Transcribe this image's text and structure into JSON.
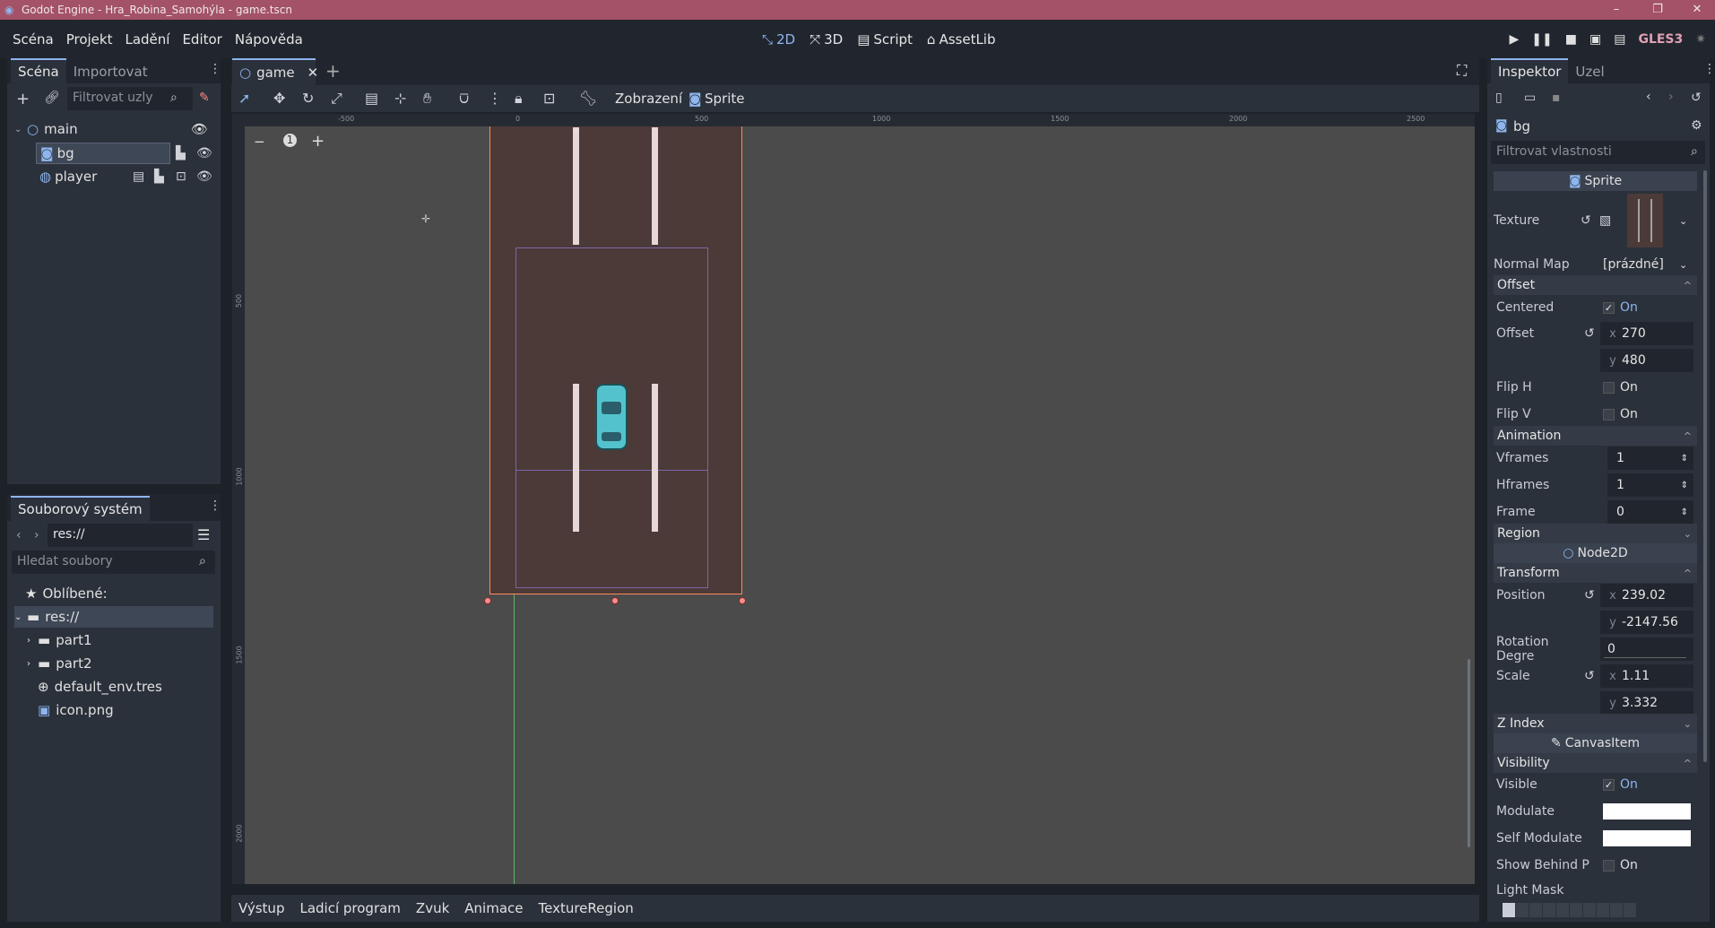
{
  "window": {
    "title": "Godot Engine - Hra_Robina_Samohýla - game.tscn",
    "controls": [
      "–",
      "❐",
      "✕"
    ]
  },
  "menu": [
    "Scéna",
    "Projekt",
    "Ladění",
    "Editor",
    "Nápověda"
  ],
  "workspaces": [
    {
      "label": "2D",
      "icon": "2d-icon",
      "active": true
    },
    {
      "label": "3D",
      "icon": "3d-icon",
      "active": false
    },
    {
      "label": "Script",
      "icon": "script-icon",
      "active": false
    },
    {
      "label": "AssetLib",
      "icon": "assetlib-icon",
      "active": false
    }
  ],
  "renderer": "GLES3",
  "scene_dock": {
    "tabs": [
      "Scéna",
      "Importovat"
    ],
    "filter_placeholder": "Filtrovat uzly",
    "nodes": [
      {
        "name": "main",
        "depth": 0,
        "icon": "node2d-icon"
      },
      {
        "name": "bg",
        "depth": 1,
        "icon": "sprite-icon",
        "selected": true
      },
      {
        "name": "player",
        "depth": 1,
        "icon": "kinematic-icon"
      }
    ]
  },
  "fs_dock": {
    "title": "Souborový systém",
    "path": "res://",
    "search_placeholder": "Hledat soubory",
    "items": [
      {
        "label": "Oblíbené:",
        "icon": "star-icon",
        "depth": 0
      },
      {
        "label": "res://",
        "icon": "folder-icon",
        "depth": 0,
        "selected": true
      },
      {
        "label": "part1",
        "icon": "folder-icon",
        "depth": 1
      },
      {
        "label": "part2",
        "icon": "folder-icon",
        "depth": 1
      },
      {
        "label": "default_env.tres",
        "icon": "environment-icon",
        "depth": 1
      },
      {
        "label": "icon.png",
        "icon": "image-icon",
        "depth": 1
      }
    ]
  },
  "editor": {
    "tab": "game",
    "view_menu": "Zobrazení",
    "sprite_menu": "Sprite",
    "zoom_minus": "−",
    "zoom_reset": "1",
    "zoom_plus": "+",
    "ruler_h": [
      "-500",
      "0",
      "500",
      "1000",
      "1500",
      "2000",
      "2500"
    ],
    "ruler_v": [
      "500",
      "1000",
      "1500",
      "2000"
    ]
  },
  "bottom_tabs": [
    "Výstup",
    "Ladicí program",
    "Zvuk",
    "Animace",
    "TextureRegion"
  ],
  "inspector": {
    "tabs": [
      "Inspektor",
      "Uzel"
    ],
    "node": "bg",
    "filter_placeholder": "Filtrovat vlastnosti",
    "class_sprite": "Sprite",
    "texture_label": "Texture",
    "normal_map_label": "Normal Map",
    "normal_map_value": "[prázdné]",
    "offset_section": "Offset",
    "centered_label": "Centered",
    "centered_value": "On",
    "offset_label": "Offset",
    "offset_x": "270",
    "offset_y": "480",
    "fliph_label": "Flip H",
    "fliph_value": "On",
    "flipv_label": "Flip V",
    "flipv_value": "On",
    "animation_section": "Animation",
    "vframes_label": "Vframes",
    "vframes_value": "1",
    "hframes_label": "Hframes",
    "hframes_value": "1",
    "frame_label": "Frame",
    "frame_value": "0",
    "region_section": "Region",
    "class_node2d": "Node2D",
    "transform_section": "Transform",
    "position_label": "Position",
    "position_x": "239.02",
    "position_y": "-2147.56",
    "rotation_label": "Rotation Degre",
    "rotation_value": "0",
    "scale_label": "Scale",
    "scale_x": "1.11",
    "scale_y": "3.332",
    "zindex_section": "Z Index",
    "class_canvasitem": "CanvasItem",
    "visibility_section": "Visibility",
    "visible_label": "Visible",
    "visible_value": "On",
    "modulate_label": "Modulate",
    "self_modulate_label": "Self Modulate",
    "show_behind_label": "Show Behind P",
    "show_behind_value": "On",
    "light_mask_label": "Light Mask",
    "axis_x": "x",
    "axis_y": "y"
  },
  "colors": {
    "accent": "#8eb5ee",
    "titlebar": "#a35267",
    "road": "#4b3a37",
    "selection": "#ff8b5a"
  }
}
